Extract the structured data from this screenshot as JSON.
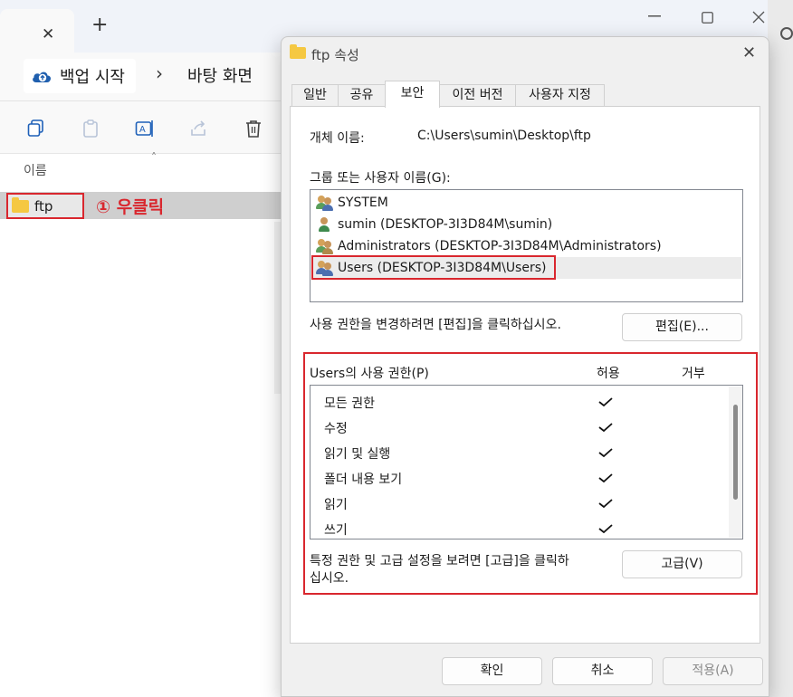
{
  "explorer": {
    "tab_close": "✕",
    "new_tab": "+",
    "crumb_main": "백업 시작",
    "crumb_sep": "›",
    "crumb_2": "바탕 화면",
    "col_name": "이름",
    "file_name": "ftp",
    "annotation": "① 우클릭"
  },
  "dialog": {
    "title": "ftp 속성",
    "close": "✕",
    "tabs": [
      "일반",
      "공유",
      "보안",
      "이전 버전",
      "사용자 지정"
    ],
    "object_label": "개체 이름:",
    "object_path": "C:\\Users\\sumin\\Desktop\\ftp",
    "group_label": "그룹 또는 사용자 이름(G):",
    "users": [
      "SYSTEM",
      "sumin (DESKTOP-3I3D84M\\sumin)",
      "Administrators (DESKTOP-3I3D84M\\Administrators)",
      "Users (DESKTOP-3I3D84M\\Users)"
    ],
    "change_hint": "사용 권한을 변경하려면 [편집]을 클릭하십시오.",
    "edit_button": "편집(E)...",
    "perm_header": "Users의 사용 권한(P)",
    "allow_col": "허용",
    "deny_col": "거부",
    "permissions": [
      {
        "name": "모든 권한",
        "allow": true
      },
      {
        "name": "수정",
        "allow": true
      },
      {
        "name": "읽기 및 실행",
        "allow": true
      },
      {
        "name": "폴더 내용 보기",
        "allow": true
      },
      {
        "name": "읽기",
        "allow": true
      },
      {
        "name": "쓰기",
        "allow": true
      }
    ],
    "advanced_hint_1": "특정 권한 및 고급 설정을 보려면 [고급]을 클릭하",
    "advanced_hint_2": "십시오.",
    "advanced_button": "고급(V)",
    "ok_button": "확인",
    "cancel_button": "취소",
    "apply_button": "적용(A)"
  },
  "colors": {
    "highlight": "#d9272e",
    "folder": "#f5c842",
    "accent": "#0067c0"
  }
}
